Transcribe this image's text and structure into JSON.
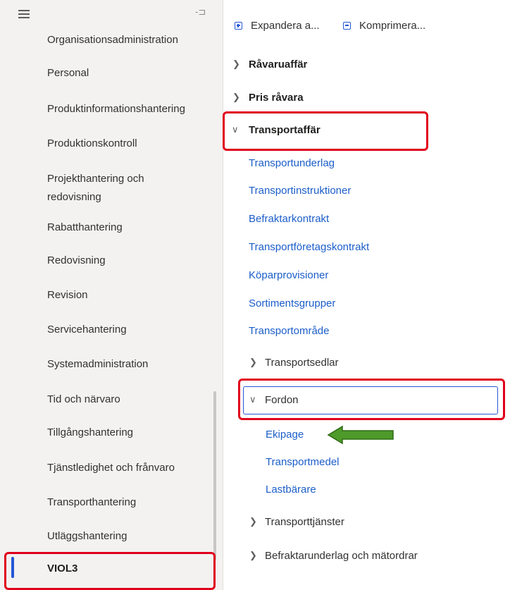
{
  "sidebar": {
    "items": [
      {
        "label": "Organisationsadministration"
      },
      {
        "label": "Personal"
      },
      {
        "label": "Produktinformationshantering"
      },
      {
        "label": "Produktionskontroll"
      },
      {
        "label": "Projekthantering och",
        "label2": "redovisning"
      },
      {
        "label": "Rabatthantering"
      },
      {
        "label": "Redovisning"
      },
      {
        "label": "Revision"
      },
      {
        "label": "Servicehantering"
      },
      {
        "label": "Systemadministration"
      },
      {
        "label": "Tid och närvaro"
      },
      {
        "label": "Tillgångshantering"
      },
      {
        "label": "Tjänstledighet och frånvaro"
      },
      {
        "label": "Transporthantering"
      },
      {
        "label": "Utläggshantering"
      },
      {
        "label": "VIOL3"
      }
    ]
  },
  "toolbar": {
    "expand_label": "Expandera a...",
    "collapse_label": "Komprimera..."
  },
  "menu": {
    "groups": [
      {
        "label": "Råvaruaffär",
        "expanded": false
      },
      {
        "label": "Pris råvara",
        "expanded": false
      },
      {
        "label": "Transportaffär",
        "expanded": true
      }
    ],
    "transport_links": [
      "Transportunderlag",
      "Transportinstruktioner",
      "Befraktarkontrakt",
      "Transportföretagskontrakt",
      "Köparprovisioner",
      "Sortimentsgrupper",
      "Transportområde"
    ],
    "subgroups": {
      "transportsedlar": "Transportsedlar",
      "fordon": "Fordon",
      "transporttjanster": "Transporttjänster",
      "befraktarunderlag": "Befraktarunderlag och mätordrar"
    },
    "fordon_links": [
      "Ekipage",
      "Transportmedel",
      "Lastbärare"
    ]
  },
  "colors": {
    "highlight_box": "#e0001b",
    "link": "#1c5ec9",
    "accent": "#2557d6",
    "arrow_fill": "#4e9a2a"
  }
}
